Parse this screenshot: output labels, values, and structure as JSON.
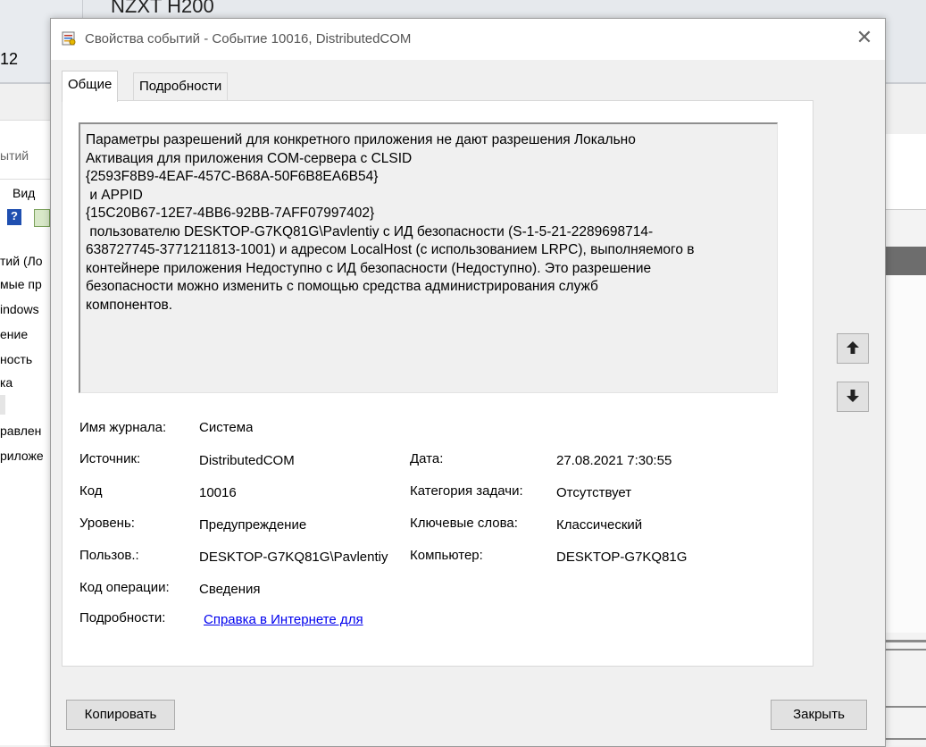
{
  "background": {
    "top_title": "NZXT H200",
    "top_number": "12",
    "left_items": [
      "ытий",
      "Вид",
      "тий (Ло",
      "мые пр",
      "indows",
      "ение",
      "ность",
      "ка",
      "равлен",
      "риложе"
    ]
  },
  "dialog": {
    "title": "Свойства событий - Событие 10016, DistributedCOM",
    "tabs": [
      "Общие",
      "Подробности"
    ],
    "description": "Параметры разрешений для конкретного приложения не дают разрешения Локально\nАктивация для приложения COM-сервера с CLSID\n{2593F8B9-4EAF-457C-B68A-50F6B8EA6B54}\n и APPID\n{15C20B67-12E7-4BB6-92BB-7AFF07997402}\n пользователю DESKTOP-G7KQ81G\\Pavlentiy с ИД безопасности (S-1-5-21-2289698714-\n638727745-3771211813-1001) и адресом LocalHost (с использованием LRPC), выполняемого в\nконтейнере приложения Недоступно с ИД безопасности (Недоступно). Это разрешение\nбезопасности можно изменить с помощью средства администрирования служб\nкомпонентов.",
    "fields": {
      "log_name_label": "Имя журнала:",
      "log_name": "Система",
      "source_label": "Источник:",
      "source": "DistributedCOM",
      "date_label": "Дата:",
      "date": "27.08.2021 7:30:55",
      "code_label": "Код",
      "code": "10016",
      "task_category_label": "Категория задачи:",
      "task_category": "Отсутствует",
      "level_label": "Уровень:",
      "level": "Предупреждение",
      "keywords_label": "Ключевые слова:",
      "keywords": "Классический",
      "user_label": "Пользов.:",
      "user": "DESKTOP-G7KQ81G\\Pavlentiy",
      "computer_label": "Компьютер:",
      "computer": "DESKTOP-G7KQ81G",
      "opcode_label": "Код операции:",
      "opcode": "Сведения",
      "more_info_label": "Подробности:",
      "more_info_link": "Справка в Интернете для"
    },
    "buttons": {
      "copy": "Копировать",
      "close": "Закрыть"
    }
  }
}
